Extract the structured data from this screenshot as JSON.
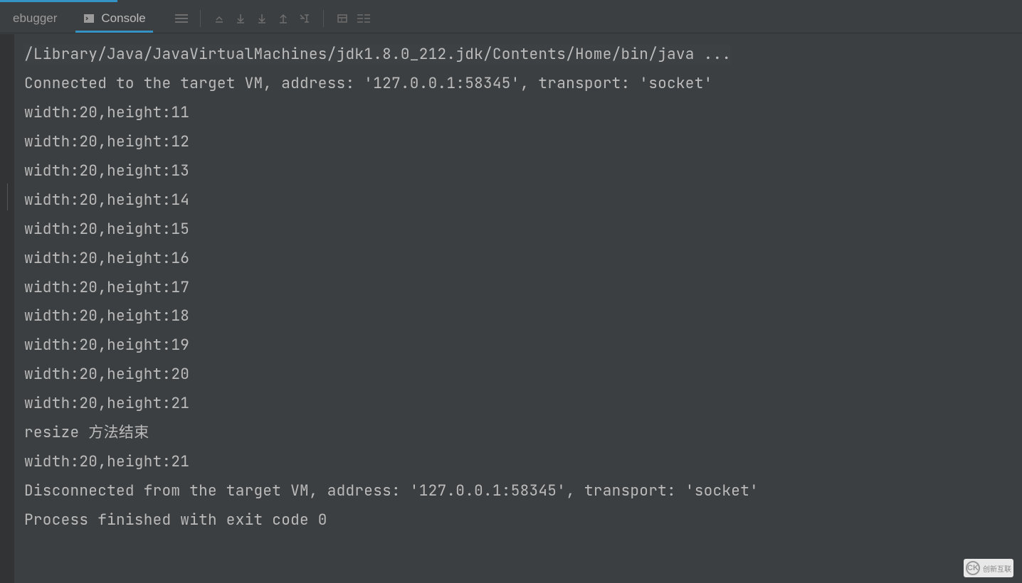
{
  "tabs": {
    "debugger": "ebugger",
    "console": "Console"
  },
  "console": {
    "cmd": "/Library/Java/JavaVirtualMachines/jdk1.8.0_212.jdk/Contents/Home/bin/java ...",
    "lines": [
      "Connected to the target VM, address: '127.0.0.1:58345', transport: 'socket'",
      "width:20,height:11",
      "width:20,height:12",
      "width:20,height:13",
      "width:20,height:14",
      "width:20,height:15",
      "width:20,height:16",
      "width:20,height:17",
      "width:20,height:18",
      "width:20,height:19",
      "width:20,height:20",
      "width:20,height:21",
      "resize 方法结束",
      "width:20,height:21",
      "Disconnected from the target VM, address: '127.0.0.1:58345', transport: 'socket'",
      "",
      "Process finished with exit code 0"
    ]
  },
  "watermark": "创新互联"
}
